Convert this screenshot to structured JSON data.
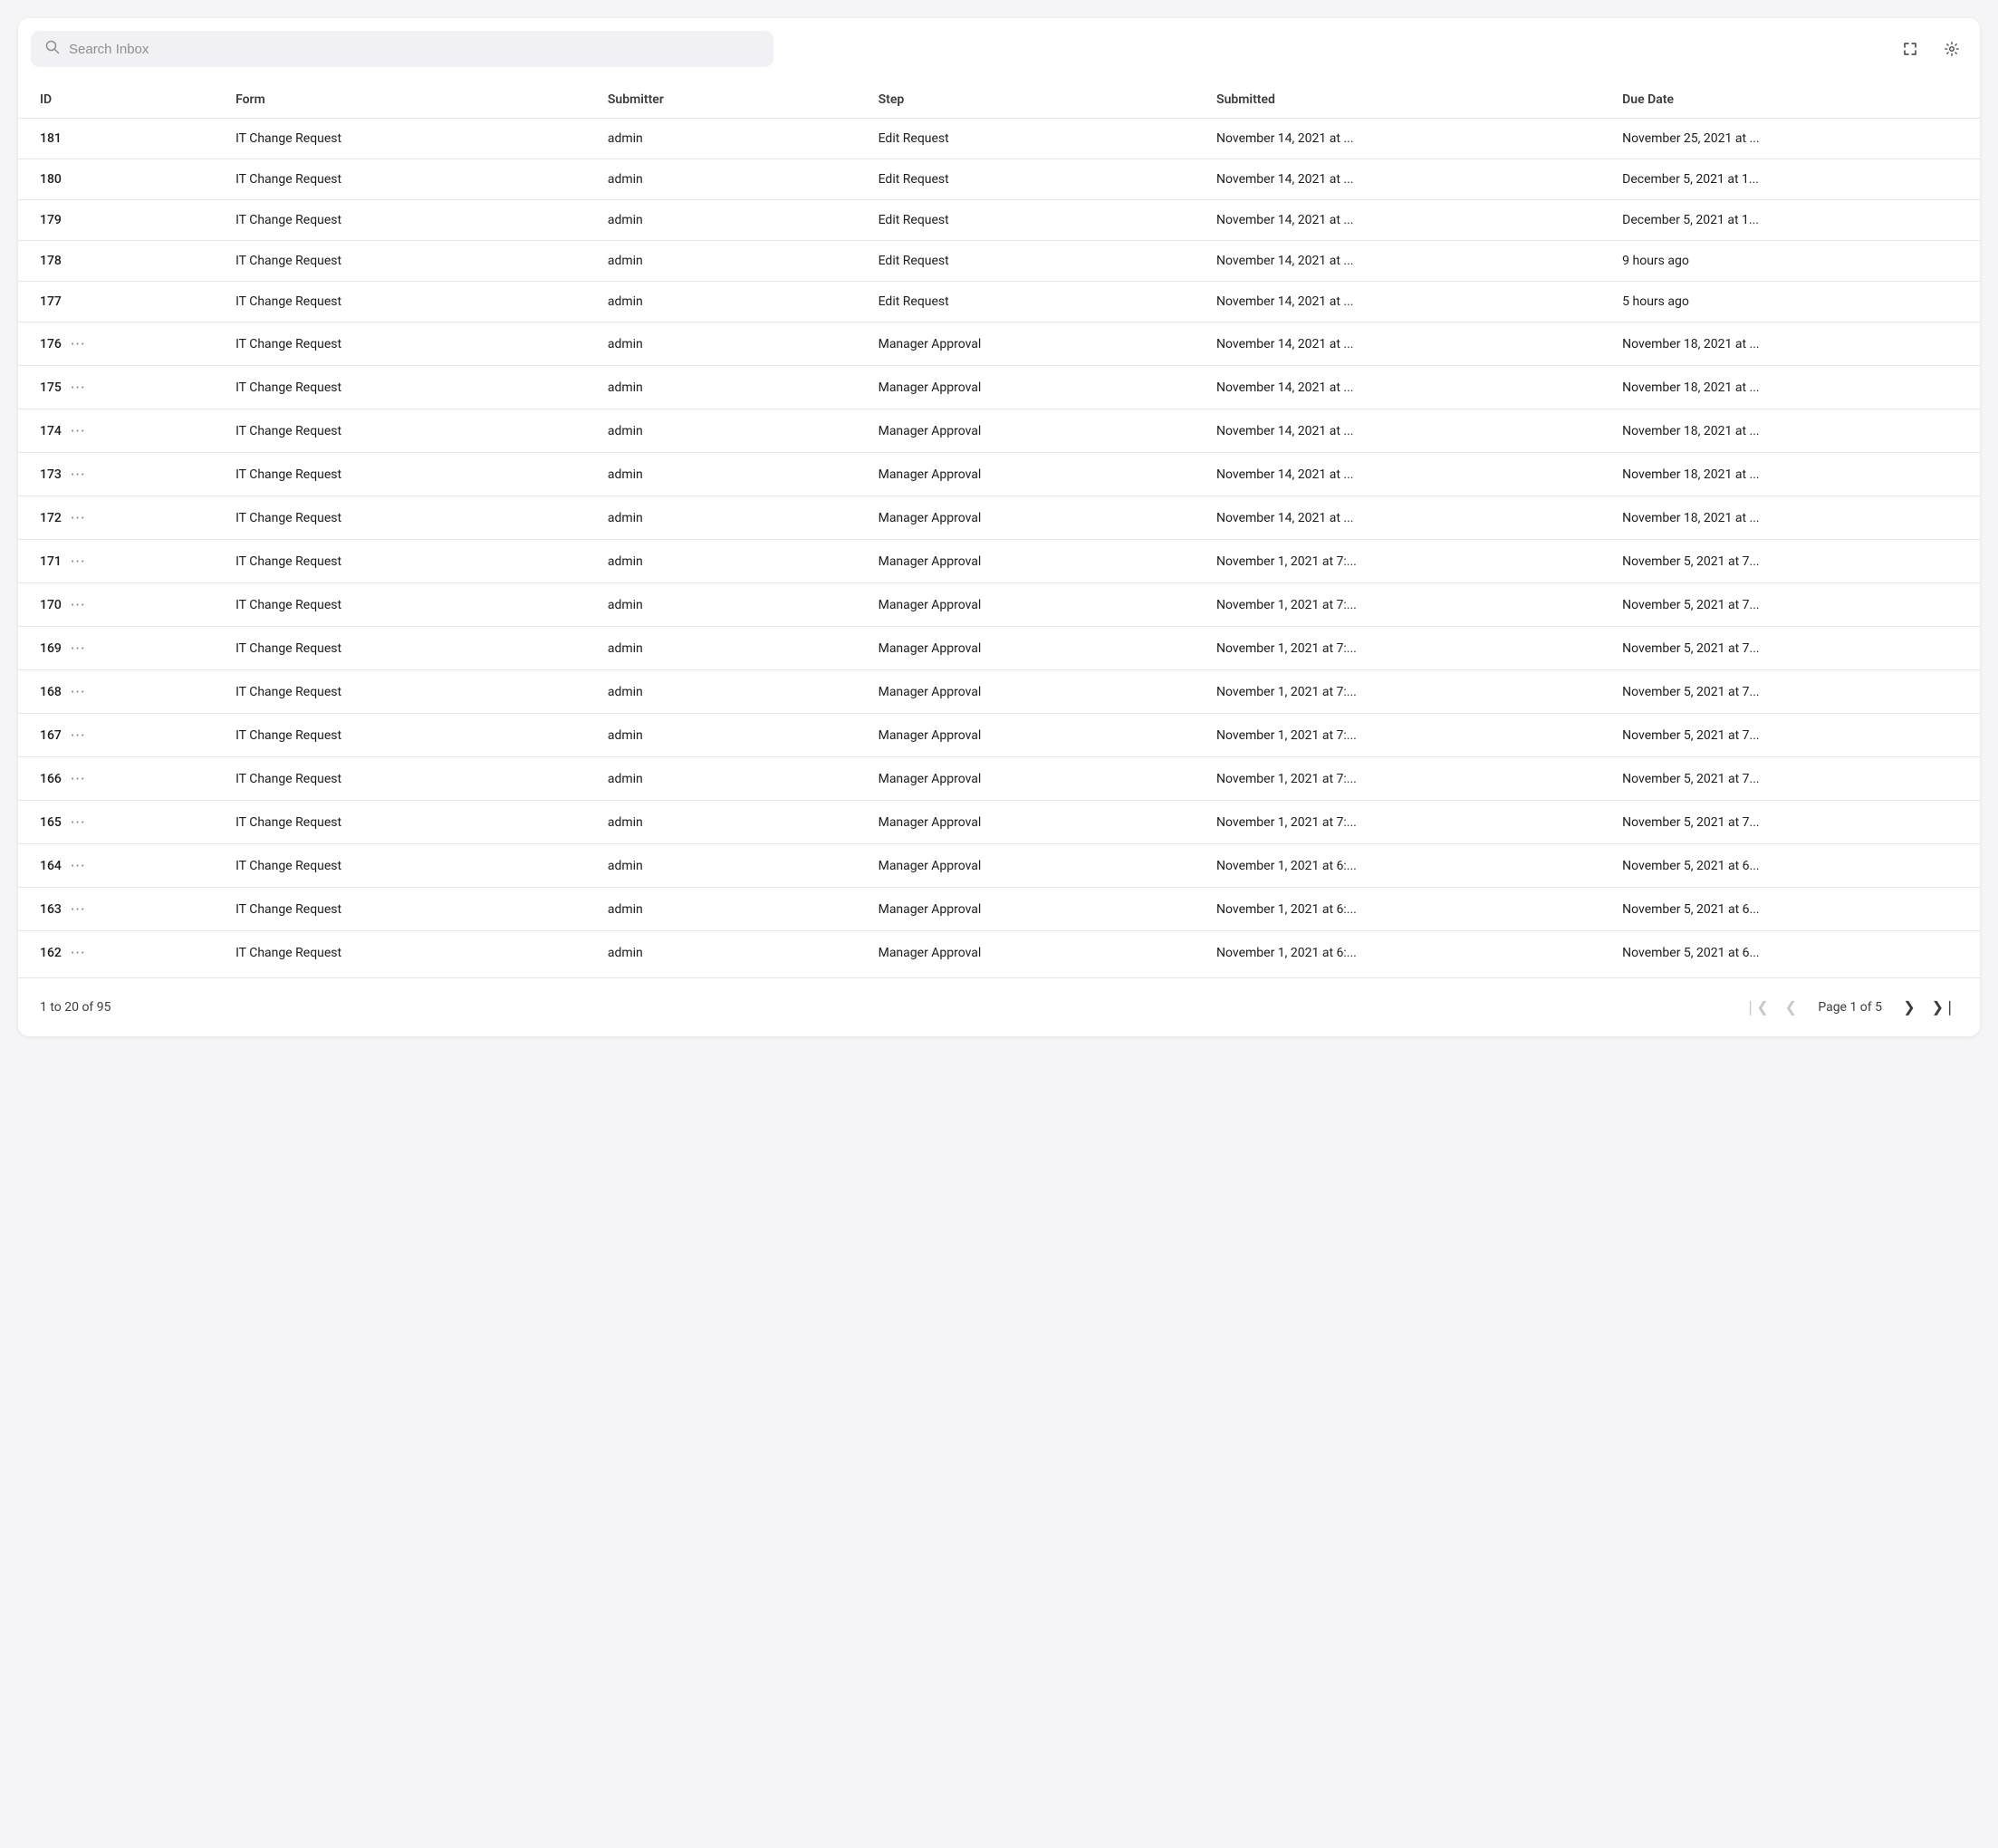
{
  "search": {
    "placeholder": "Search Inbox",
    "value": ""
  },
  "toolbar": {
    "expand_icon": "⤢",
    "settings_icon": "⚙"
  },
  "table": {
    "columns": [
      {
        "key": "id",
        "label": "ID"
      },
      {
        "key": "form",
        "label": "Form"
      },
      {
        "key": "submitter",
        "label": "Submitter"
      },
      {
        "key": "step",
        "label": "Step"
      },
      {
        "key": "submitted",
        "label": "Submitted"
      },
      {
        "key": "dueDate",
        "label": "Due Date"
      }
    ],
    "rows": [
      {
        "id": "181",
        "hasDots": false,
        "form": "IT Change Request",
        "submitter": "admin",
        "step": "Edit Request",
        "submitted": "November 14, 2021 at ...",
        "dueDate": "November 25, 2021 at ..."
      },
      {
        "id": "180",
        "hasDots": false,
        "form": "IT Change Request",
        "submitter": "admin",
        "step": "Edit Request",
        "submitted": "November 14, 2021 at ...",
        "dueDate": "December 5, 2021 at 1..."
      },
      {
        "id": "179",
        "hasDots": false,
        "form": "IT Change Request",
        "submitter": "admin",
        "step": "Edit Request",
        "submitted": "November 14, 2021 at ...",
        "dueDate": "December 5, 2021 at 1..."
      },
      {
        "id": "178",
        "hasDots": false,
        "form": "IT Change Request",
        "submitter": "admin",
        "step": "Edit Request",
        "submitted": "November 14, 2021 at ...",
        "dueDate": "9 hours ago"
      },
      {
        "id": "177",
        "hasDots": false,
        "form": "IT Change Request",
        "submitter": "admin",
        "step": "Edit Request",
        "submitted": "November 14, 2021 at ...",
        "dueDate": "5 hours ago"
      },
      {
        "id": "176",
        "hasDots": true,
        "form": "IT Change Request",
        "submitter": "admin",
        "step": "Manager Approval",
        "submitted": "November 14, 2021 at ...",
        "dueDate": "November 18, 2021 at ..."
      },
      {
        "id": "175",
        "hasDots": true,
        "form": "IT Change Request",
        "submitter": "admin",
        "step": "Manager Approval",
        "submitted": "November 14, 2021 at ...",
        "dueDate": "November 18, 2021 at ..."
      },
      {
        "id": "174",
        "hasDots": true,
        "form": "IT Change Request",
        "submitter": "admin",
        "step": "Manager Approval",
        "submitted": "November 14, 2021 at ...",
        "dueDate": "November 18, 2021 at ..."
      },
      {
        "id": "173",
        "hasDots": true,
        "form": "IT Change Request",
        "submitter": "admin",
        "step": "Manager Approval",
        "submitted": "November 14, 2021 at ...",
        "dueDate": "November 18, 2021 at ..."
      },
      {
        "id": "172",
        "hasDots": true,
        "form": "IT Change Request",
        "submitter": "admin",
        "step": "Manager Approval",
        "submitted": "November 14, 2021 at ...",
        "dueDate": "November 18, 2021 at ..."
      },
      {
        "id": "171",
        "hasDots": true,
        "form": "IT Change Request",
        "submitter": "admin",
        "step": "Manager Approval",
        "submitted": "November 1, 2021 at 7:...",
        "dueDate": "November 5, 2021 at 7..."
      },
      {
        "id": "170",
        "hasDots": true,
        "form": "IT Change Request",
        "submitter": "admin",
        "step": "Manager Approval",
        "submitted": "November 1, 2021 at 7:...",
        "dueDate": "November 5, 2021 at 7..."
      },
      {
        "id": "169",
        "hasDots": true,
        "form": "IT Change Request",
        "submitter": "admin",
        "step": "Manager Approval",
        "submitted": "November 1, 2021 at 7:...",
        "dueDate": "November 5, 2021 at 7..."
      },
      {
        "id": "168",
        "hasDots": true,
        "form": "IT Change Request",
        "submitter": "admin",
        "step": "Manager Approval",
        "submitted": "November 1, 2021 at 7:...",
        "dueDate": "November 5, 2021 at 7..."
      },
      {
        "id": "167",
        "hasDots": true,
        "form": "IT Change Request",
        "submitter": "admin",
        "step": "Manager Approval",
        "submitted": "November 1, 2021 at 7:...",
        "dueDate": "November 5, 2021 at 7..."
      },
      {
        "id": "166",
        "hasDots": true,
        "form": "IT Change Request",
        "submitter": "admin",
        "step": "Manager Approval",
        "submitted": "November 1, 2021 at 7:...",
        "dueDate": "November 5, 2021 at 7..."
      },
      {
        "id": "165",
        "hasDots": true,
        "form": "IT Change Request",
        "submitter": "admin",
        "step": "Manager Approval",
        "submitted": "November 1, 2021 at 7:...",
        "dueDate": "November 5, 2021 at 7..."
      },
      {
        "id": "164",
        "hasDots": true,
        "form": "IT Change Request",
        "submitter": "admin",
        "step": "Manager Approval",
        "submitted": "November 1, 2021 at 6:...",
        "dueDate": "November 5, 2021 at 6..."
      },
      {
        "id": "163",
        "hasDots": true,
        "form": "IT Change Request",
        "submitter": "admin",
        "step": "Manager Approval",
        "submitted": "November 1, 2021 at 6:...",
        "dueDate": "November 5, 2021 at 6..."
      },
      {
        "id": "162",
        "hasDots": true,
        "form": "IT Change Request",
        "submitter": "admin",
        "step": "Manager Approval",
        "submitted": "November 1, 2021 at 6:...",
        "dueDate": "November 5, 2021 at 6..."
      }
    ]
  },
  "footer": {
    "range_label": "1 to 20 of 95",
    "page_label": "Page",
    "current_page": "1",
    "of_label": "of",
    "total_pages": "5"
  }
}
